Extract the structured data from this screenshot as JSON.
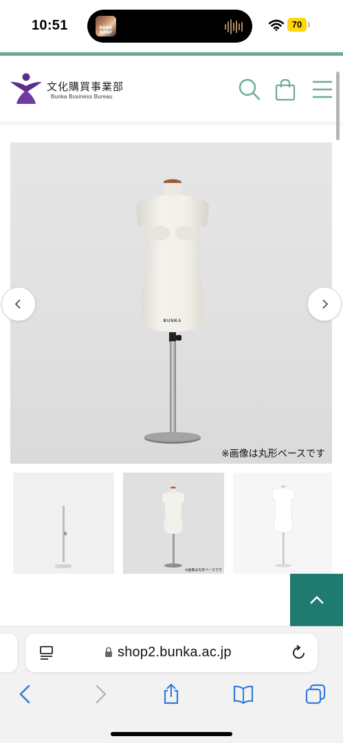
{
  "status_bar": {
    "time": "10:51",
    "now_playing_art_text": "RANG BANF",
    "battery_level": "70",
    "wifi_icon": "wifi-icon",
    "colors": {
      "battery": "#ffd60a"
    }
  },
  "header": {
    "logo_text_jp": "文化購買事業部",
    "logo_text_en": "Bunka Business Bureau",
    "icons": [
      "search-icon",
      "shopping-bag-icon",
      "hamburger-menu-icon"
    ],
    "colors": {
      "accent": "#69aa98",
      "logo_purple": "#5b2d8c"
    }
  },
  "product_gallery": {
    "main_image_caption": "※画像は丸形ベースです",
    "mannequin_brand": "BUNKA",
    "prev_icon": "chevron-left-icon",
    "next_icon": "chevron-right-icon",
    "thumbnails": [
      {
        "name": "stand-only"
      },
      {
        "name": "mannequin-round-base",
        "caption": "※画像は丸形ベースです"
      },
      {
        "name": "mannequin-white"
      }
    ]
  },
  "back_to_top": {
    "icon": "chevron-up-icon",
    "color": "#1f7a70"
  },
  "browser": {
    "url": "shop2.bunka.ac.jp",
    "icons": [
      "reader-icon",
      "lock-icon",
      "reload-icon",
      "back-icon",
      "forward-icon",
      "share-icon",
      "bookmarks-icon",
      "tabs-icon"
    ],
    "colors": {
      "toolbar_tint": "#2f7bd8"
    }
  }
}
